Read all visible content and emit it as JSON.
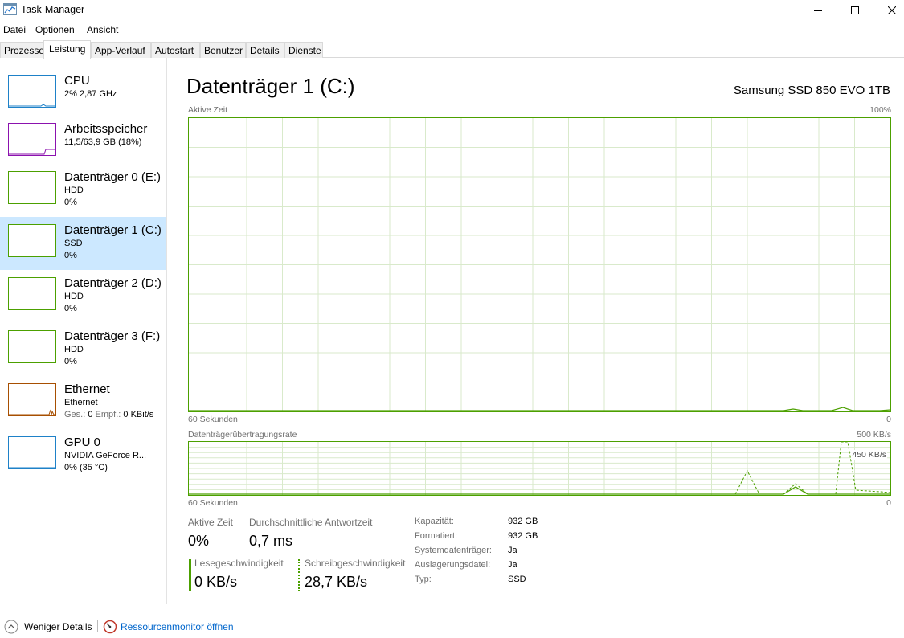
{
  "window": {
    "title": "Task-Manager",
    "controls": [
      "minimize",
      "maximize",
      "close"
    ]
  },
  "menu": [
    "Datei",
    "Optionen",
    "Ansicht"
  ],
  "tabs": [
    {
      "label": "Prozesse",
      "active": false
    },
    {
      "label": "Leistung",
      "active": true
    },
    {
      "label": "App-Verlauf",
      "active": false
    },
    {
      "label": "Autostart",
      "active": false
    },
    {
      "label": "Benutzer",
      "active": false
    },
    {
      "label": "Details",
      "active": false
    },
    {
      "label": "Dienste",
      "active": false
    }
  ],
  "sidebar": {
    "items": [
      {
        "name": "CPU",
        "sub1": "2% 2,87 GHz",
        "sub2": "",
        "color": "#1e81c8"
      },
      {
        "name": "Arbeitsspeicher",
        "sub1": "11,5/63,9 GB (18%)",
        "sub2": "",
        "color": "#8b12ae"
      },
      {
        "name": "Datenträger 0 (E:)",
        "sub1": "HDD",
        "sub2": "0%",
        "color": "#4ca000"
      },
      {
        "name": "Datenträger 1 (C:)",
        "sub1": "SSD",
        "sub2": "0%",
        "color": "#4ca000"
      },
      {
        "name": "Datenträger 2 (D:)",
        "sub1": "HDD",
        "sub2": "0%",
        "color": "#4ca000"
      },
      {
        "name": "Datenträger 3 (F:)",
        "sub1": "HDD",
        "sub2": "0%",
        "color": "#4ca000"
      },
      {
        "name": "Ethernet",
        "sub1": "Ethernet",
        "sub2_label1": "Ges.:",
        "sub2_val1": "0",
        "sub2_label2": "Empf.:",
        "sub2_val2": "0 KBit/s",
        "color": "#a74f01"
      },
      {
        "name": "GPU 0",
        "sub1": "NVIDIA GeForce R...",
        "sub2": "0% (35 °C)",
        "color": "#1e81c8"
      }
    ]
  },
  "main": {
    "title": "Datenträger 1 (C:)",
    "device": "Samsung SSD 850 EVO 1TB",
    "graph1": {
      "label": "Aktive Zeit",
      "max_label": "100%",
      "time_label": "60 Sekunden",
      "min_label": "0"
    },
    "graph2": {
      "label": "Datenträgerübertragungsrate",
      "max_label": "500 KB/s",
      "inner_label": "450 KB/s",
      "time_label": "60 Sekunden",
      "min_label": "0"
    },
    "stats": {
      "active_time_label": "Aktive Zeit",
      "active_time_value": "0%",
      "response_label": "Durchschnittliche Antwortzeit",
      "response_value": "0,7 ms",
      "read_label": "Lesegeschwindigkeit",
      "read_value": "0 KB/s",
      "write_label": "Schreibgeschwindigkeit",
      "write_value": "28,7 KB/s"
    },
    "properties": [
      {
        "label": "Kapazität:",
        "value": "932 GB"
      },
      {
        "label": "Formatiert:",
        "value": "932 GB"
      },
      {
        "label": "Systemdatenträger:",
        "value": "Ja"
      },
      {
        "label": "Auslagerungsdatei:",
        "value": "Ja"
      },
      {
        "label": "Typ:",
        "value": "SSD"
      }
    ]
  },
  "footer": {
    "fewer_details": "Weniger Details",
    "resource_monitor": "Ressourcenmonitor öffnen"
  },
  "colors": {
    "disk": "#4ca000",
    "grid": "#d9eacb",
    "selected": "#cce8ff"
  }
}
